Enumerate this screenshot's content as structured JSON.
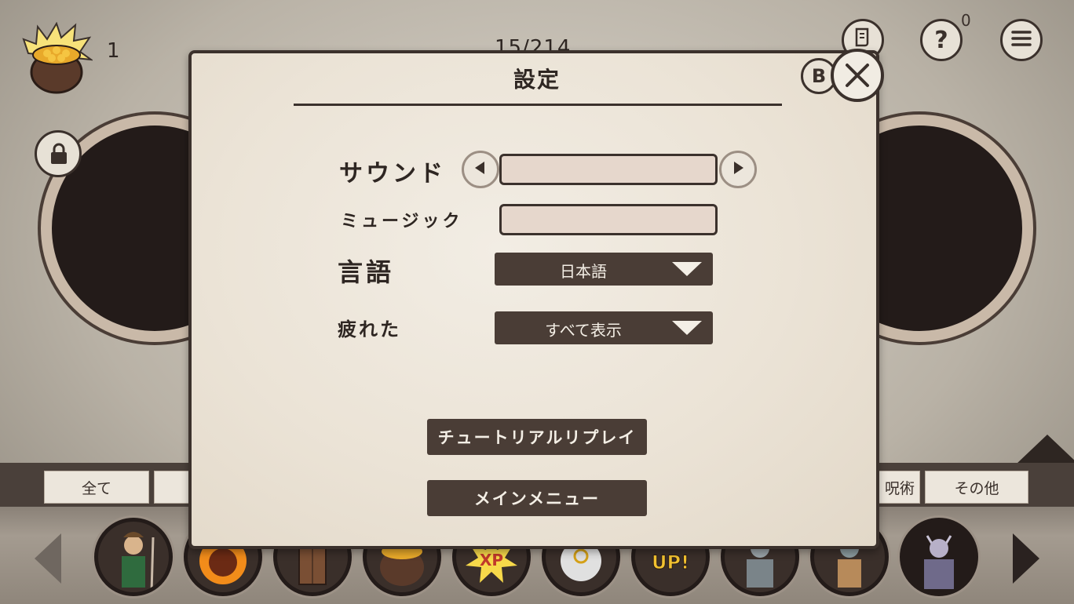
{
  "hud": {
    "coin_count": "1",
    "progress": "15/214",
    "help_badge_count": "0",
    "help_symbol": "?"
  },
  "tabs": [
    {
      "label": "全て"
    },
    {
      "label": "呪術"
    },
    {
      "label": "その他"
    }
  ],
  "dialog": {
    "title": "設定",
    "gamepad_close_hint": "B",
    "sound_label": "サウンド",
    "music_label": "ミュージック",
    "language_label": "言語",
    "language_value": "日本語",
    "tired_label": "疲れた",
    "tired_value": "すべて表示",
    "tutorial_button": "チュートリアルリプレイ",
    "main_menu_button": "メインメニュー"
  },
  "card_labels": {
    "xp": "XP",
    "up": "UP!"
  },
  "colors": {
    "panel_dark": "#4a3d36",
    "panel_border": "#3b312c",
    "parchment": "#ebe3d6"
  }
}
